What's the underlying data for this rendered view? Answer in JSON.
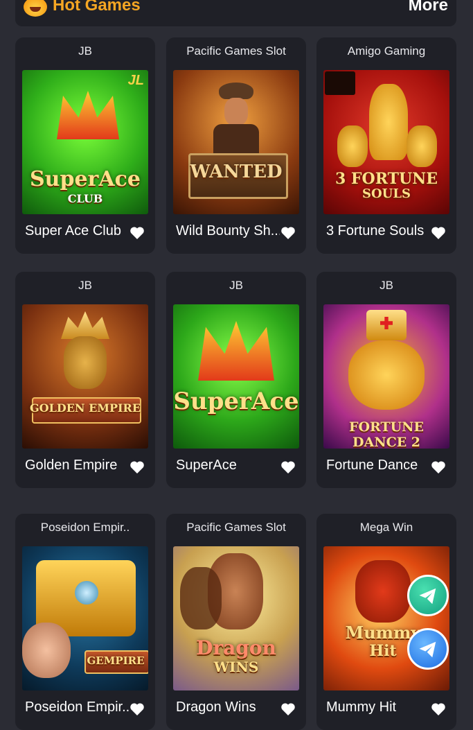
{
  "header": {
    "title": "Hot Games",
    "more_label": "More"
  },
  "games": [
    {
      "provider": "JB",
      "name": "Super Ace Club",
      "art": "SuperAce",
      "art_sub": "CLUB"
    },
    {
      "provider": "Pacific Games Slot",
      "name": "Wild Bounty Sh...",
      "art": "WANTED",
      "art_sub": ""
    },
    {
      "provider": "Amigo Gaming",
      "name": "3 Fortune Souls",
      "art": "3 FORTUNE",
      "art_sub": "SOULS"
    },
    {
      "provider": "JB",
      "name": "Golden Empire",
      "art": "GOLDEN EMPIRE",
      "art_sub": ""
    },
    {
      "provider": "JB",
      "name": "SuperAce",
      "art": "SuperAce",
      "art_sub": ""
    },
    {
      "provider": "JB",
      "name": "Fortune Dance",
      "art": "FORTUNE DANCE 2",
      "art_sub": ""
    },
    {
      "provider": "Poseidon Empir..",
      "name": "Poseidon Empir...",
      "art": "GEMPIRE",
      "art_sub": ""
    },
    {
      "provider": "Pacific Games Slot",
      "name": "Dragon Wins",
      "art": "Dragon",
      "art_sub": "WINS"
    },
    {
      "provider": "Mega Win",
      "name": "Mummy Hit",
      "art": "Mummy",
      "art_sub": "Hit"
    }
  ],
  "icons": {
    "header": "fire-emoji-icon",
    "favorite": "heart-icon",
    "chat_1": "telegram-icon",
    "chat_2": "telegram-icon"
  },
  "colors": {
    "background": "#2b2c34",
    "card": "#1f2027",
    "accent": "#f5a623"
  }
}
